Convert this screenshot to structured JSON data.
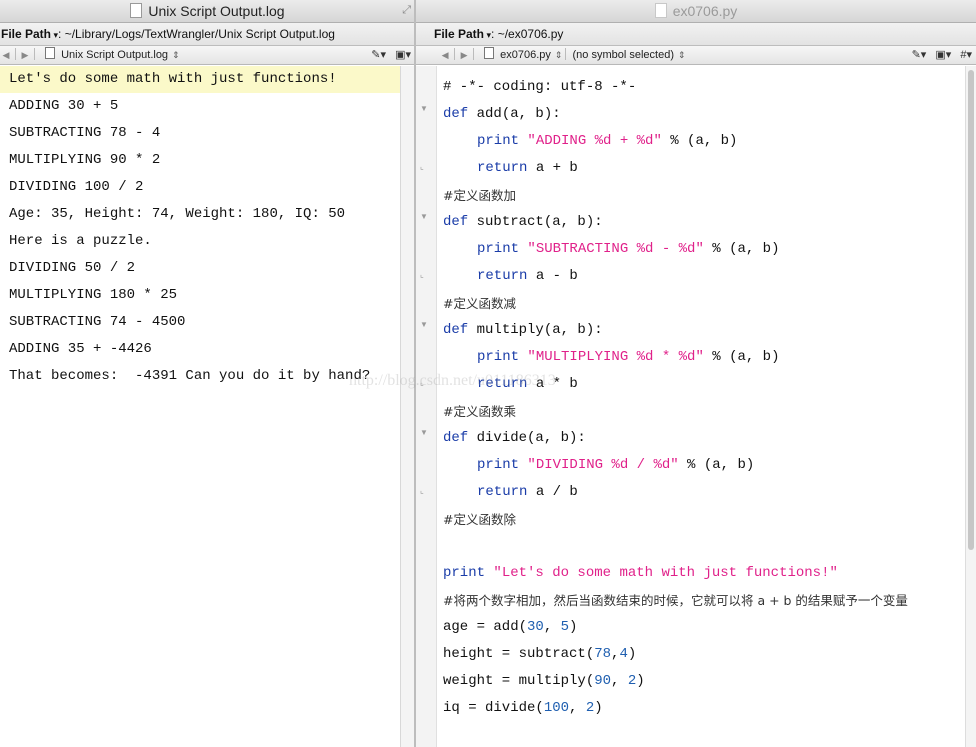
{
  "left": {
    "title": "Unix Script Output.log",
    "path_label": "File Path",
    "path_value": ": ~/Library/Logs/TextWrangler/Unix Script Output.log",
    "doc_name": "Unix Script Output.log",
    "output_lines": [
      "Let's do some math with just functions!",
      "ADDING 30 + 5",
      "SUBTRACTING 78 - 4",
      "MULTIPLYING 90 * 2",
      "DIVIDING 100 / 2",
      "Age: 35, Height: 74, Weight: 180, IQ: 50",
      "Here is a puzzle.",
      "DIVIDING 50 / 2",
      "MULTIPLYING 180 * 25",
      "SUBTRACTING 74 - 4500",
      "ADDING 35 + -4426",
      "That becomes:  -4391 Can you do it by hand?"
    ]
  },
  "right": {
    "title": "ex0706.py",
    "path_label": "File Path",
    "path_value": ": ~/ex0706.py",
    "doc_name": "ex0706.py",
    "symbol": "(no symbol selected)",
    "code": {
      "l1": "# -*- coding: utf-8 -*-",
      "def": "def",
      "print": "print",
      "return": "return",
      "add_sig": " add(a, b):",
      "add_str": "\"ADDING %d + %d\"",
      "fmt_args": " % (a, b)",
      "add_ret": " a + b",
      "add_cmt": "#定义函数加",
      "sub_sig": " subtract(a, b):",
      "sub_str": "\"SUBTRACTING %d - %d\"",
      "sub_ret": " a - b",
      "sub_cmt": "#定义函数减",
      "mul_sig": " multiply(a, b):",
      "mul_str": "\"MULTIPLYING %d * %d\"",
      "mul_ret": " a * b",
      "mul_cmt": "#定义函数乘",
      "div_sig": " divide(a, b):",
      "div_str": "\"DIVIDING %d / %d\"",
      "div_ret": " a / b",
      "div_cmt": "#定义函数除",
      "main_str": "\"Let's do some math with just functions!\"",
      "main_cmt": "#将两个数字相加，然后当函数结束的时候，它就可以将 a + b 的结果赋予一个变量",
      "age_pre": "age = add(",
      "age_a": "30",
      "age_mid": ", ",
      "age_b": "5",
      "height_pre": "height = subtract(",
      "height_a": "78",
      "height_mid": ",",
      "height_b": "4",
      "weight_pre": "weight = multiply(",
      "weight_a": "90",
      "weight_mid": ", ",
      "weight_b": "2",
      "iq_pre": "iq = divide(",
      "iq_a": "100",
      "iq_mid": ", ",
      "iq_b": "2",
      "close": ")"
    }
  },
  "watermark": "http://blog.csdn.net/u011186313"
}
